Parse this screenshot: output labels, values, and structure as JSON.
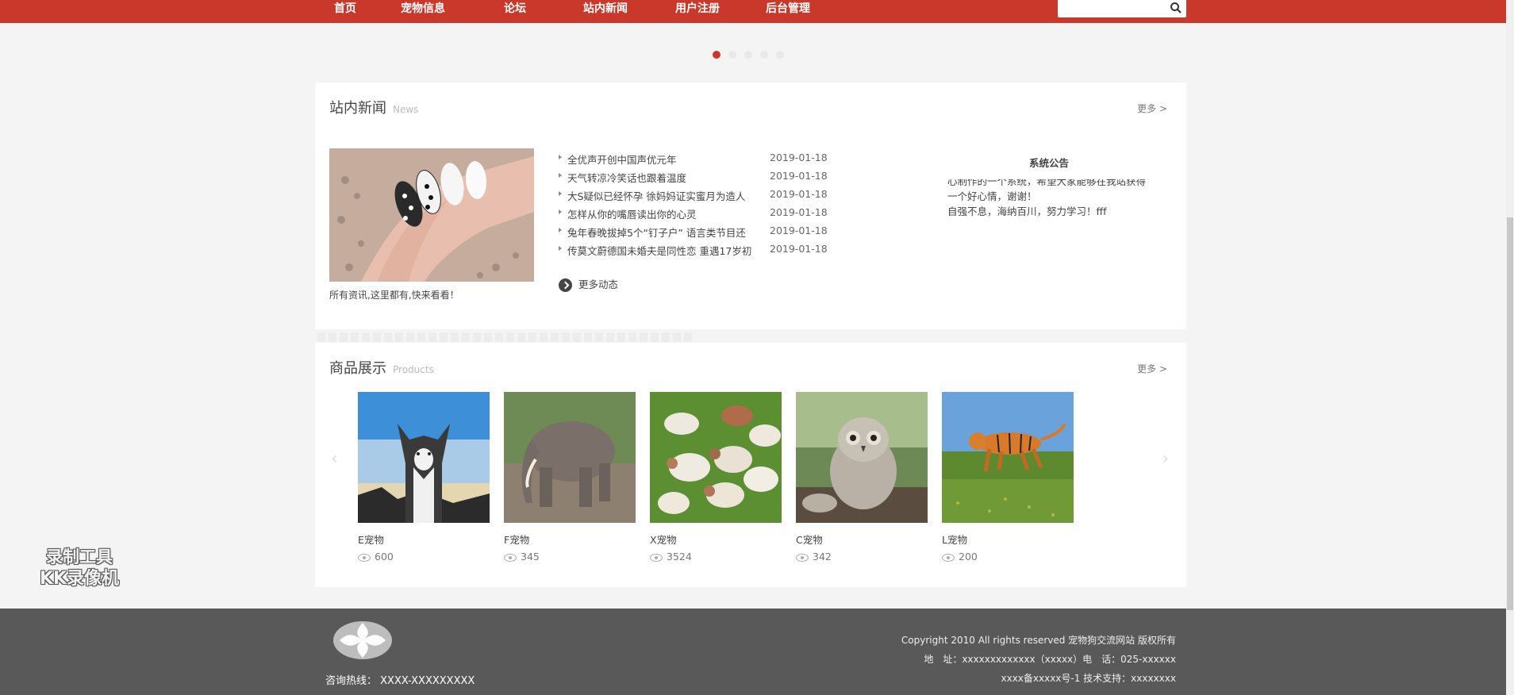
{
  "nav": {
    "items": [
      {
        "label": "首页"
      },
      {
        "label": "宠物信息"
      },
      {
        "label": "论坛"
      },
      {
        "label": "站内新闻"
      },
      {
        "label": "用户注册"
      },
      {
        "label": "后台管理"
      }
    ],
    "search_placeholder": ""
  },
  "colors": {
    "brand": "#c9382a",
    "footer": "#595959"
  },
  "news": {
    "title": "站内新闻",
    "subtitle": "News",
    "more": "更多 >",
    "feature_caption": "所有资讯,这里都有,快来看看！",
    "items": [
      {
        "title": "全优声开创中国声优元年",
        "date": "2019-01-18"
      },
      {
        "title": "天气转凉冷笑话也跟着温度",
        "date": "2019-01-18"
      },
      {
        "title": "大S疑似已经怀孕 徐妈妈证实蜜月为造人",
        "date": "2019-01-18"
      },
      {
        "title": "怎样从你的嘴唇读出你的心灵",
        "date": "2019-01-18"
      },
      {
        "title": "兔年春晚拔掉5个“钉子户” 语言类节目还",
        "date": "2019-01-18"
      },
      {
        "title": "传莫文蔚德国未婚夫是同性恋 重遇17岁初",
        "date": "2019-01-18"
      }
    ],
    "more_news": "更多动态",
    "notice_title": "系统公告",
    "notice_lines": [
      "心制作的一个系统，希望大家能够在我站获得",
      "一个好心情，谢谢！",
      "自强不息，海纳百川，努力学习！fff"
    ]
  },
  "products": {
    "title": "商品展示",
    "subtitle": "Products",
    "more": "更多 >",
    "items": [
      {
        "name": "E宠物",
        "views": "600",
        "icon": "husky-image"
      },
      {
        "name": "F宠物",
        "views": "345",
        "icon": "elephant-image"
      },
      {
        "name": "X宠物",
        "views": "3524",
        "icon": "sheep-image"
      },
      {
        "name": "C宠物",
        "views": "342",
        "icon": "owl-image"
      },
      {
        "name": "L宠物",
        "views": "200",
        "icon": "tiger-image"
      }
    ]
  },
  "footer": {
    "hotline": "咨询热线： XXXX-XXXXXXXXX",
    "copyright": "Copyright 2010 All rights reserved 宠物狗交流网站 版权所有",
    "address": "地　址：xxxxxxxxxxxxx（xxxxx）电　话：025-xxxxxx",
    "icp": "xxxx备xxxxx号-1 技术支持：xxxxxxxx"
  },
  "watermark": {
    "line1": "录制工具",
    "line2": "KK录像机"
  }
}
